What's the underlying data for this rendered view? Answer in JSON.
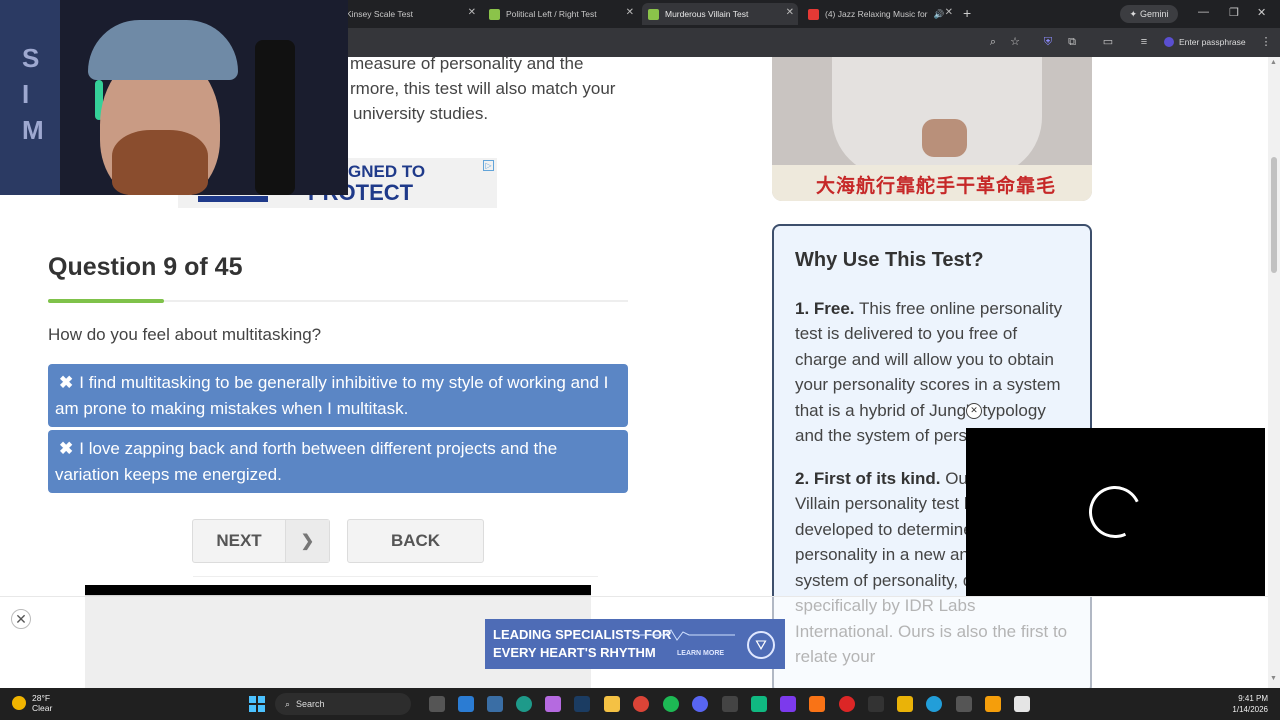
{
  "browser": {
    "tabs": [
      {
        "title": "Kinsey Scale Test",
        "active": false
      },
      {
        "title": "Political Left / Right Test",
        "active": false
      },
      {
        "title": "Murderous Villain Test",
        "active": true
      },
      {
        "title": "(4) Jazz Relaxing Music for",
        "active": false
      }
    ],
    "gemini_label": "Gemini",
    "passphrase_label": "Enter passphrase"
  },
  "page": {
    "intro_lines": [
      "measure of personality and the",
      "rmore, this test will also match your",
      "university studies."
    ],
    "top_ad": {
      "line1": "GNED TO",
      "line2": "PROTECT"
    },
    "question": {
      "title": "Question 9 of 45",
      "progress": 0.2,
      "text": "How do you feel about multitasking?",
      "answers": [
        "I find multitasking to be generally inhibitive to my style of working and I am prone to making mistakes when I multitask.",
        "I love zapping back and forth between different projects and the variation keeps me energized."
      ]
    },
    "buttons": {
      "next": "NEXT",
      "back": "BACK"
    },
    "poster_caption": "大海航行靠舵手干革命靠毛",
    "why": {
      "heading": "Why Use This Test?",
      "p1_bold": "1. Free.",
      "p1_text": " This free online personality test is delivered to you free of charge and will allow you to obtain your personality scores in a system that is a hybrid of Jung's typology and the system of personality",
      "p2_bold": "2. First of its kind.",
      "p2_text": " Our Murderous Villain personality test has been developed to determine your personality in a new and unique system of personality, developed specifically by IDR Labs International. Ours is also the first to relate your"
    },
    "bottom_ad": {
      "line1": "LEADING SPECIALISTS FOR",
      "line2": "EVERY HEART'S RHYTHM",
      "learn": "LEARN MORE"
    }
  },
  "taskbar": {
    "weather_temp": "28°F",
    "weather_desc": "Clear",
    "search": "Search",
    "time": "9:41 PM",
    "date": "1/14/2026"
  }
}
